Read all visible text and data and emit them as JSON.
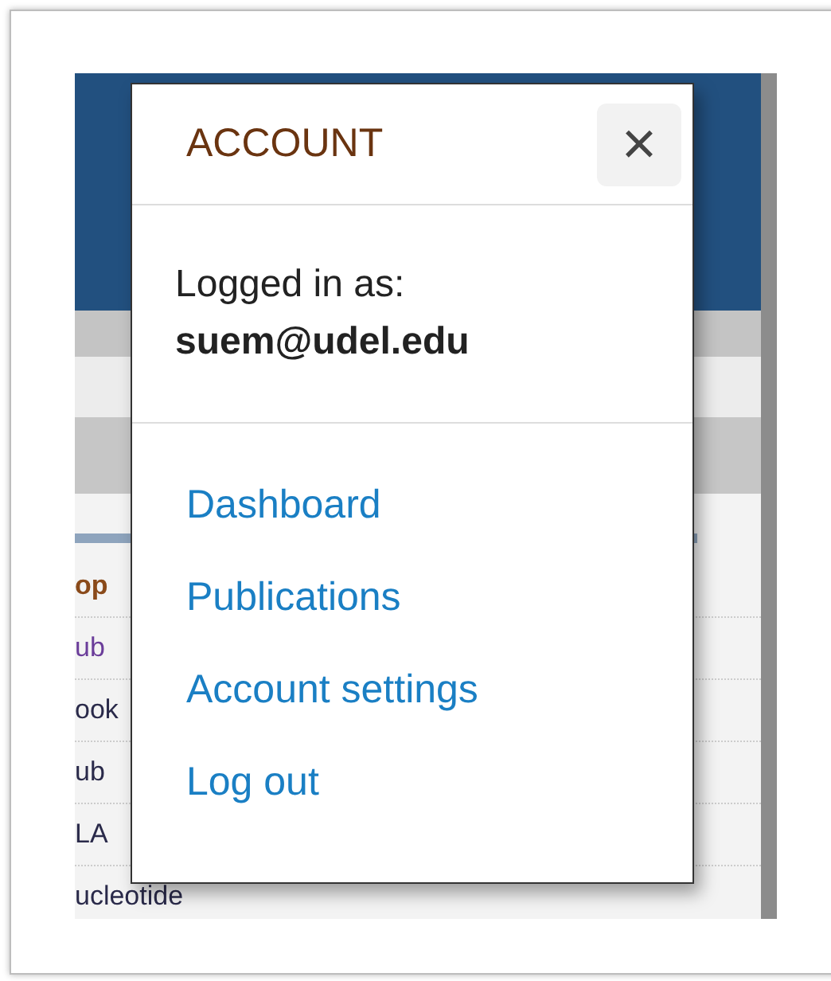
{
  "background_list": [
    {
      "text": "op",
      "kind": "heading"
    },
    {
      "text": "ub",
      "kind": "visited"
    },
    {
      "text": "ook",
      "kind": "link"
    },
    {
      "text": "ub",
      "kind": "link"
    },
    {
      "text": "LA",
      "kind": "link"
    },
    {
      "text": "ucleotide",
      "kind": "link"
    }
  ],
  "account_menu": {
    "title": "ACCOUNT",
    "close": "×",
    "logged_in_label": "Logged in as:",
    "user_email": "suem@udel.edu",
    "links": [
      "Dashboard",
      "Publications",
      "Account settings",
      "Log out"
    ]
  }
}
